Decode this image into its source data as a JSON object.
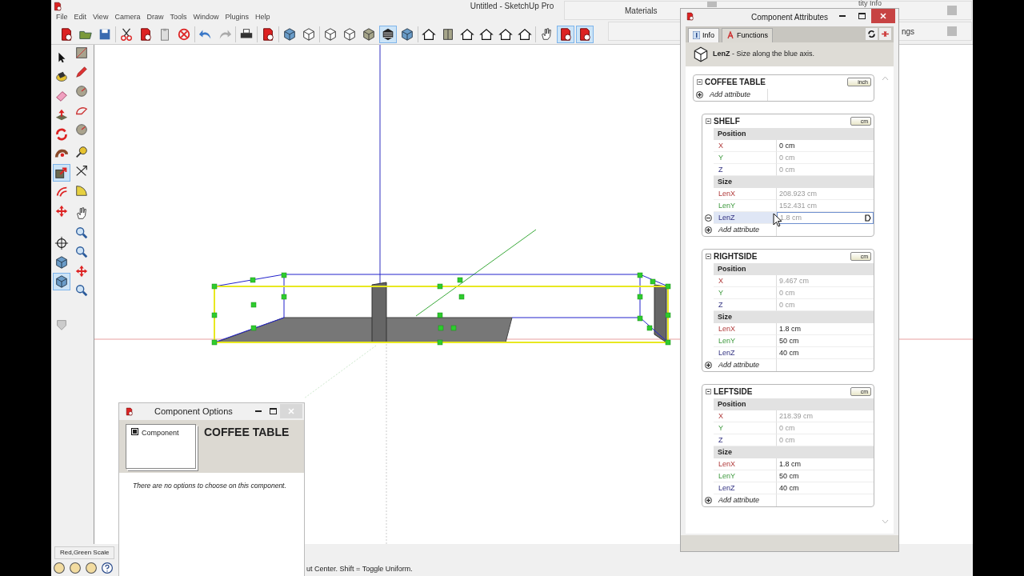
{
  "window": {
    "title": "Untitled - SketchUp Pro"
  },
  "menu": [
    "File",
    "Edit",
    "View",
    "Camera",
    "Draw",
    "Tools",
    "Window",
    "Plugins",
    "Help"
  ],
  "trays": [
    {
      "label": "Materials"
    },
    {
      "label": "tity Info"
    },
    {
      "label": "ngs"
    }
  ],
  "toolbar": {
    "groups": [
      [
        {
          "selected": false
        },
        {
          "selected": false
        },
        {
          "selected": false
        }
      ],
      [
        {
          "selected": false
        },
        {
          "selected": false
        },
        {
          "selected": false
        },
        {
          "selected": false
        }
      ],
      [
        {
          "selected": false
        },
        {
          "selected": false
        }
      ],
      [
        {
          "selected": false
        }
      ],
      [
        {
          "selected": false
        }
      ],
      [
        {
          "selected": false
        },
        {
          "selected": false
        }
      ],
      [
        {
          "selected": false
        },
        {
          "selected": false
        },
        {
          "selected": false
        },
        {
          "selected": true
        },
        {
          "selected": false
        }
      ],
      [
        {
          "selected": false
        },
        {
          "selected": false
        },
        {
          "selected": false
        },
        {
          "selected": false
        },
        {
          "selected": false
        },
        {
          "selected": false
        }
      ],
      [
        {
          "selected": false
        },
        {
          "selected": true
        },
        {
          "selected": true
        }
      ]
    ]
  },
  "side_toolbar": {
    "left": [
      [
        {
          "selected": false
        },
        {
          "selected": false
        },
        {
          "selected": false
        },
        {
          "selected": false
        },
        {
          "selected": false
        },
        {
          "selected": false
        },
        {
          "selected": true
        },
        {
          "selected": false
        },
        {
          "selected": false
        }
      ],
      [
        {
          "selected": false
        },
        {
          "selected": false
        },
        {
          "selected": true
        }
      ],
      [
        {
          "selected": false
        }
      ]
    ],
    "right": [
      [
        {
          "selected": false
        },
        {
          "selected": false
        },
        {
          "selected": false
        },
        {
          "selected": false
        },
        {
          "selected": false
        }
      ],
      [
        {
          "selected": false
        },
        {
          "selected": false
        },
        {
          "selected": false
        }
      ],
      [
        {
          "selected": false
        },
        {
          "selected": false
        },
        {
          "selected": false
        },
        {
          "selected": false
        },
        {
          "selected": false
        }
      ]
    ]
  },
  "attributes_dialog": {
    "title": "Component Attributes",
    "tabs": [
      {
        "label": "Info",
        "selected": true
      },
      {
        "label": "Functions",
        "selected": false
      }
    ],
    "info": "**LenZ** - Size along the blue axis.",
    "components": [
      {
        "name": "COFFEE TABLE",
        "unit": "inch",
        "add_label": "Add attribute",
        "children": [
          {
            "name": "SHELF",
            "unit": "cm",
            "add_label": "Add attribute",
            "groups": [
              {
                "title": "Position",
                "rows": [
                  {
                    "label": "X",
                    "value": "0 cm",
                    "kind": "red",
                    "dimmed": false,
                    "selected": false
                  },
                  {
                    "label": "Y",
                    "value": "0 cm",
                    "kind": "green",
                    "dimmed": true,
                    "selected": false
                  },
                  {
                    "label": "Z",
                    "value": "0 cm",
                    "kind": "blue",
                    "dimmed": true,
                    "selected": false
                  }
                ]
              },
              {
                "title": "Size",
                "rows": [
                  {
                    "label": "LenX",
                    "value": "208.923 cm",
                    "kind": "red",
                    "dimmed": true,
                    "selected": false
                  },
                  {
                    "label": "LenY",
                    "value": "152.431 cm",
                    "kind": "green",
                    "dimmed": true,
                    "selected": false
                  },
                  {
                    "label": "LenZ",
                    "value": "1.8 cm",
                    "kind": "blue",
                    "dimmed": true,
                    "selected": true
                  }
                ]
              }
            ]
          },
          {
            "name": "RIGHTSIDE",
            "unit": "cm",
            "add_label": "Add attribute",
            "groups": [
              {
                "title": "Position",
                "rows": [
                  {
                    "label": "X",
                    "value": "9.467 cm",
                    "kind": "red",
                    "dimmed": true,
                    "selected": false
                  },
                  {
                    "label": "Y",
                    "value": "0 cm",
                    "kind": "green",
                    "dimmed": true,
                    "selected": false
                  },
                  {
                    "label": "Z",
                    "value": "0 cm",
                    "kind": "blue",
                    "dimmed": true,
                    "selected": false
                  }
                ]
              },
              {
                "title": "Size",
                "rows": [
                  {
                    "label": "LenX",
                    "value": "1.8 cm",
                    "kind": "red",
                    "dimmed": false,
                    "selected": false
                  },
                  {
                    "label": "LenY",
                    "value": "50 cm",
                    "kind": "green",
                    "dimmed": false,
                    "selected": false
                  },
                  {
                    "label": "LenZ",
                    "value": "40 cm",
                    "kind": "blue",
                    "dimmed": false,
                    "selected": false
                  }
                ]
              }
            ]
          },
          {
            "name": "LEFTSIDE",
            "unit": "cm",
            "add_label": "Add attribute",
            "groups": [
              {
                "title": "Position",
                "rows": [
                  {
                    "label": "X",
                    "value": "218.39 cm",
                    "kind": "red",
                    "dimmed": true,
                    "selected": false
                  },
                  {
                    "label": "Y",
                    "value": "0 cm",
                    "kind": "green",
                    "dimmed": true,
                    "selected": false
                  },
                  {
                    "label": "Z",
                    "value": "0 cm",
                    "kind": "blue",
                    "dimmed": true,
                    "selected": false
                  }
                ]
              },
              {
                "title": "Size",
                "rows": [
                  {
                    "label": "LenX",
                    "value": "1.8 cm",
                    "kind": "red",
                    "dimmed": false,
                    "selected": false
                  },
                  {
                    "label": "LenY",
                    "value": "50 cm",
                    "kind": "green",
                    "dimmed": false,
                    "selected": false
                  },
                  {
                    "label": "LenZ",
                    "value": "40 cm",
                    "kind": "blue",
                    "dimmed": false,
                    "selected": false
                  }
                ]
              }
            ]
          }
        ]
      }
    ]
  },
  "options_dialog": {
    "title": "Component Options",
    "thumbnail_label": "Component",
    "heading": "COFFEE TABLE",
    "message": "There are no options to choose on this component."
  },
  "status": {
    "hint": "Red,Green Scale",
    "message": "ut Center. Shift = Toggle Uniform."
  }
}
